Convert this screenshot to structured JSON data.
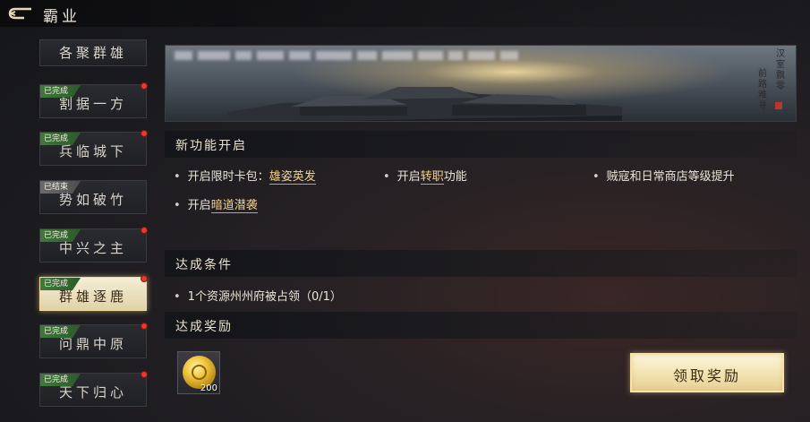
{
  "header": {
    "title": "霸业",
    "back_icon": "back-arrow-icon"
  },
  "sidebar": {
    "items": [
      {
        "label": "各聚群雄",
        "status": "",
        "dot": false,
        "selected": false
      },
      {
        "label": "割据一方",
        "status": "已完成",
        "dot": true,
        "selected": false
      },
      {
        "label": "兵临城下",
        "status": "已完成",
        "dot": true,
        "selected": false
      },
      {
        "label": "势如破竹",
        "status": "已结束",
        "dot": false,
        "selected": false
      },
      {
        "label": "中兴之主",
        "status": "已完成",
        "dot": true,
        "selected": false
      },
      {
        "label": "群雄逐鹿",
        "status": "已完成",
        "dot": true,
        "selected": true
      },
      {
        "label": "问鼎中原",
        "status": "已完成",
        "dot": true,
        "selected": false
      },
      {
        "label": "天下归心",
        "status": "已完成",
        "dot": true,
        "selected": false
      }
    ]
  },
  "banner": {
    "poem_col1": "汉室飘零",
    "poem_col2": "前路难寻"
  },
  "new_features": {
    "title": "新功能开启",
    "item1_prefix": "开启限时卡包：",
    "item1_link": "雄姿英发",
    "item2_prefix": "开启",
    "item2_link": "转职",
    "item2_suffix": "功能",
    "item3": "贼寇和日常商店等级提升",
    "item4_prefix": "开启",
    "item4_link": "暗道潜袭"
  },
  "conditions": {
    "title": "达成条件",
    "item1": "1个资源州州府被占领（0/1）"
  },
  "rewards": {
    "title": "达成奖励",
    "items": [
      {
        "icon": "gold-coin-icon",
        "quantity": "200"
      }
    ],
    "claim_label": "领取奖励"
  },
  "colors": {
    "accent_gold": "#f3d28a",
    "status_done": "#3f7a3a",
    "status_ended": "#6c6c6c",
    "red_dot": "#e63a2c"
  }
}
